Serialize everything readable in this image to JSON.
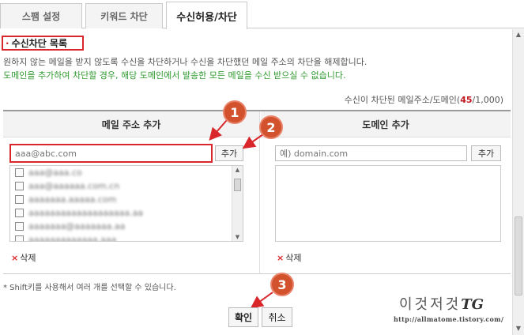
{
  "tabs": [
    {
      "label": "스팸 설정"
    },
    {
      "label": "키워드 차단"
    },
    {
      "label": "수신허용/차단"
    }
  ],
  "section": {
    "title": "수신차단 목록",
    "desc1": "원하지 않는 메일을 받지 않도록 수신을 차단하거나 수신을 차단했던 메일 주소의 차단을 해제합니다.",
    "desc2": "도메인을 추가하여 차단할 경우, 해당 도메인에서 발송한 모든 메일을 수신 받으실 수 없습니다.",
    "count_prefix": "수신이 차단된 메일주소/도메인(",
    "count_value": "45",
    "count_suffix": "/1,000)"
  },
  "email_panel": {
    "heading": "메일 주소 추가",
    "placeholder": "aaa@abc.com",
    "add_label": "추가",
    "delete_label": "삭제",
    "items": [
      "aaa@aaa.co",
      "aaa@aaaaaa.com.cn",
      "aaaaaaa.aaaaa.com",
      "aaaaaaaaaaaaaaaaaaa.aa",
      "aaaaaaa@aaaaaaa.aa",
      "aaaaaaaaaaaaa.aaa"
    ]
  },
  "domain_panel": {
    "heading": "도메인 추가",
    "placeholder": "예) domain.com",
    "add_label": "추가",
    "delete_label": "삭제"
  },
  "note": "* Shift키를 사용해서 여러 개를 선택할 수 있습니다.",
  "buttons": {
    "confirm": "확인",
    "cancel": "취소"
  },
  "badges": [
    "1",
    "2",
    "3"
  ],
  "watermark": {
    "text": "이것저것",
    "logo": "TG",
    "url": "http://allmatome.tistory.com/"
  },
  "colors": {
    "highlight_red": "#d9262b",
    "badge": "#d3522e",
    "green_text": "#2f9a2f"
  }
}
